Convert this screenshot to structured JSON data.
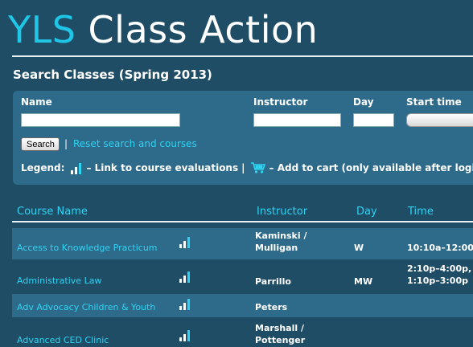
{
  "header": {
    "title_accent": "YLS",
    "title_rest": " Class Action"
  },
  "page_title": "Search Classes (Spring 2013)",
  "search": {
    "name_label": "Name",
    "name_value": "",
    "instructor_label": "Instructor",
    "instructor_value": "",
    "day_label": "Day",
    "day_value": "",
    "start_time_label": "Start time",
    "start_time_value": "",
    "search_button": "Search",
    "separator": "|",
    "reset_link": "Reset search and courses"
  },
  "legend": {
    "label": "Legend:",
    "evaluations_text": "– Link to course evaluations",
    "separator": "|",
    "cart_text": "– Add to cart (only available after login)"
  },
  "table": {
    "columns": [
      "Course Name",
      "Instructor",
      "Day",
      "Time"
    ],
    "rows": [
      {
        "name": "Access to Knowledge Practicum",
        "instructor_lines": [
          "Kaminski /",
          "Mulligan"
        ],
        "day": "W",
        "time_lines": [
          "10:10a–12:00"
        ]
      },
      {
        "name": "Administrative Law",
        "instructor_lines": [
          "Parrillo"
        ],
        "day": "MW",
        "time_lines": [
          "2:10p–4:00p,",
          "1:10p–3:00p"
        ]
      },
      {
        "name": "Adv Advocacy Children & Youth",
        "instructor_lines": [
          "Peters"
        ],
        "day": "",
        "time_lines": []
      },
      {
        "name": "Advanced CED Clinic",
        "instructor_lines": [
          "Marshall /",
          "Pottenger"
        ],
        "day": "",
        "time_lines": []
      }
    ]
  },
  "colors": {
    "background": "#1f4d66",
    "panel": "#2e6b8a",
    "accent": "#2ed3f2"
  },
  "icons": {
    "evaluations": "bar-chart-icon",
    "cart": "shopping-cart-icon"
  }
}
